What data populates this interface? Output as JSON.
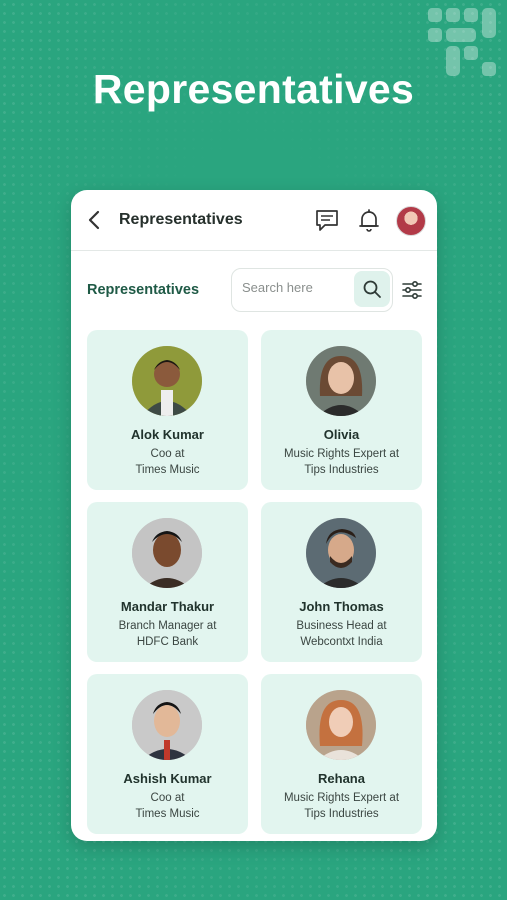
{
  "hero": {
    "title": "Representatives"
  },
  "header": {
    "title": "Representatives"
  },
  "toolbar": {
    "label": "Representatives",
    "search_placeholder": "Search here"
  },
  "colors": {
    "background": "#2aa57f",
    "card": "#e2f5ef",
    "accent_text": "#1f5a46"
  },
  "icons": [
    "back-icon",
    "chat-icon",
    "bell-icon",
    "search-icon",
    "filter-icon"
  ],
  "representatives": [
    {
      "name": "Alok Kumar",
      "role_line1": "Coo at",
      "role_line2": "Times Music"
    },
    {
      "name": "Olivia",
      "role_line1": "Music Rights Expert at",
      "role_line2": "Tips Industries"
    },
    {
      "name": "Mandar Thakur",
      "role_line1": "Branch Manager at",
      "role_line2": "HDFC Bank"
    },
    {
      "name": "John Thomas",
      "role_line1": "Business Head at",
      "role_line2": "Webcontxt India"
    },
    {
      "name": "Ashish Kumar",
      "role_line1": "Coo at",
      "role_line2": "Times Music"
    },
    {
      "name": "Rehana",
      "role_line1": "Music Rights Expert at",
      "role_line2": "Tips Industries"
    }
  ]
}
